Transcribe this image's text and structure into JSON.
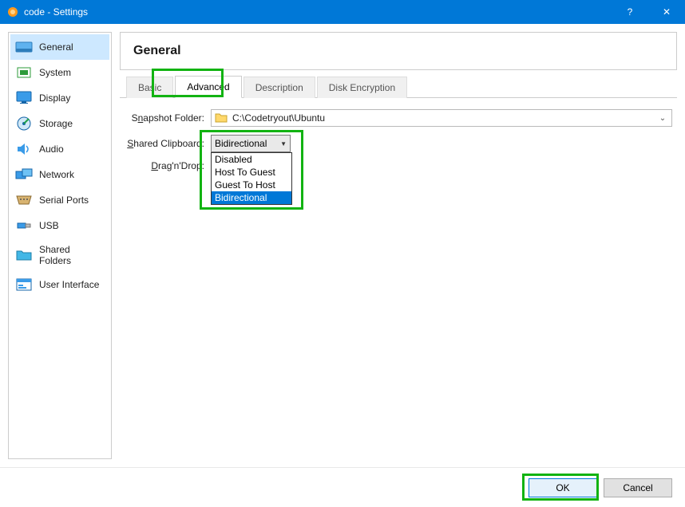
{
  "window": {
    "title": "code - Settings",
    "help": "?",
    "close": "✕"
  },
  "sidebar": {
    "items": [
      {
        "label": "General",
        "icon": "general-icon"
      },
      {
        "label": "System",
        "icon": "system-icon"
      },
      {
        "label": "Display",
        "icon": "display-icon"
      },
      {
        "label": "Storage",
        "icon": "storage-icon"
      },
      {
        "label": "Audio",
        "icon": "audio-icon"
      },
      {
        "label": "Network",
        "icon": "network-icon"
      },
      {
        "label": "Serial Ports",
        "icon": "serial-icon"
      },
      {
        "label": "USB",
        "icon": "usb-icon"
      },
      {
        "label": "Shared Folders",
        "icon": "folder-icon"
      },
      {
        "label": "User Interface",
        "icon": "ui-icon"
      }
    ]
  },
  "main": {
    "heading": "General",
    "tabs": [
      {
        "label": "Basic"
      },
      {
        "label": "Advanced"
      },
      {
        "label": "Description"
      },
      {
        "label": "Disk Encryption"
      }
    ],
    "snapshot": {
      "label": "Snapshot Folder:",
      "value": "C:\\Codetryout\\Ubuntu"
    },
    "clipboard": {
      "label": "Shared Clipboard:",
      "value": "Bidirectional",
      "options": [
        "Disabled",
        "Host To Guest",
        "Guest To Host",
        "Bidirectional"
      ]
    },
    "dragdrop": {
      "label": "Drag'n'Drop:"
    }
  },
  "footer": {
    "ok": "OK",
    "cancel": "Cancel"
  }
}
